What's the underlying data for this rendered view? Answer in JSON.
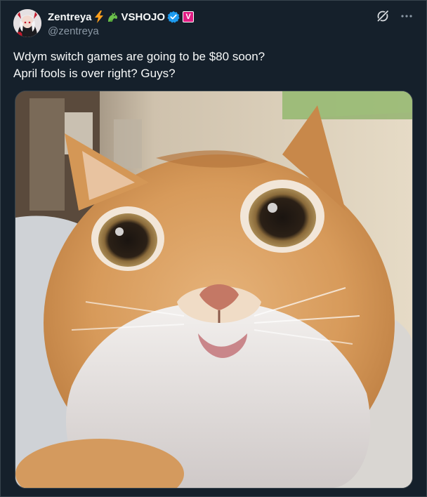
{
  "author": {
    "display_name": "Zentreya",
    "affiliation": "VSHOJO",
    "handle": "@zentreya",
    "verified_badge": "verified-check-icon",
    "affiliate_badge_letter": "V",
    "emojis": [
      "lightning-emoji",
      "dragon-emoji"
    ]
  },
  "tweet": {
    "lines": [
      "Wdym switch games are going to be $80 soon?",
      "April fools is over right? Guys?"
    ]
  },
  "colors": {
    "background": "#15202b",
    "text": "#f7f9f9",
    "secondary_text": "#8b98a5",
    "verified_blue": "#1d9bf0",
    "affiliate_pink": "#e11d84",
    "border": "#38444d"
  },
  "media": {
    "type": "image",
    "subject": "close-up of an orange and white cat with wide eyes"
  },
  "actions": {
    "grok_icon": "grok-icon",
    "more_icon": "more-icon"
  }
}
